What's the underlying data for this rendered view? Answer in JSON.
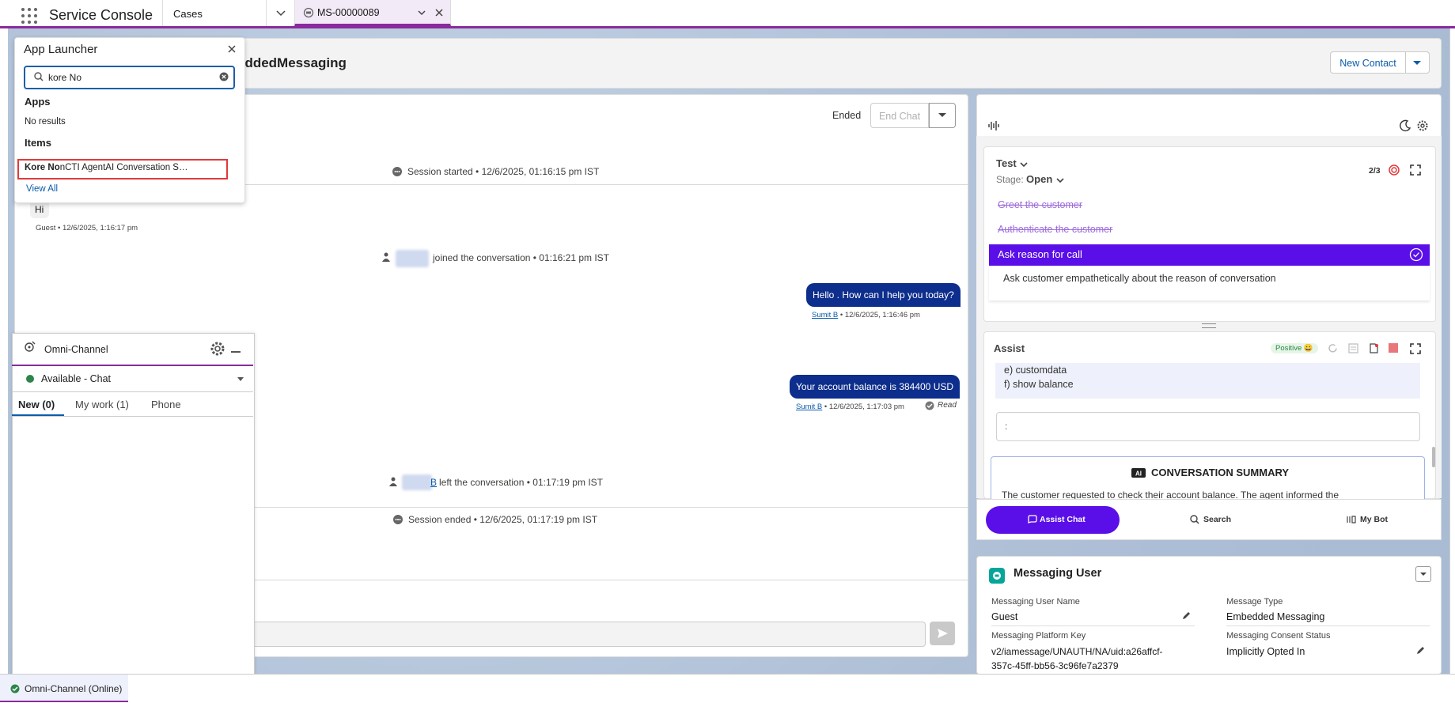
{
  "topbar": {
    "app_title": "Service Console",
    "tabs": [
      {
        "label": "Cases"
      },
      {
        "label": "MS-00000089"
      }
    ]
  },
  "header": {
    "title": "eddedMessaging",
    "new_contact_label": "New Contact"
  },
  "chat": {
    "status": "Ended",
    "end_chat_label": "End Chat",
    "session_started": "Session started • 12/6/2025, 01:16:15 pm IST",
    "guest_message": "Hi",
    "guest_meta": "Guest • 12/6/2025, 1:16:17 pm",
    "joined_text": "joined the conversation • 01:16:21 pm IST",
    "agent_message_1": "Hello . How can I help you today?",
    "agent_name_1": "Sumit B",
    "agent_meta_1": " • 12/6/2025, 1:16:46 pm",
    "agent_message_2": "Your account balance is 384400 USD",
    "agent_name_2": "Sumit B",
    "agent_meta_2": " • 12/6/2025, 1:17:03 pm",
    "read_label": "Read",
    "left_name_suffix": "B",
    "left_text": "left the conversation • 01:17:19 pm IST",
    "session_ended": "Session ended • 12/6/2025, 01:17:19 pm IST"
  },
  "launcher": {
    "title": "App Launcher",
    "search_value": "kore No",
    "apps_heading": "Apps",
    "no_results": "No results",
    "items_heading": "Items",
    "item_bold": "Kore No",
    "item_rest": "nCTI AgentAI Conversation S…",
    "view_all": "View All"
  },
  "omni": {
    "title": "Omni-Channel",
    "status": "Available - Chat",
    "status_color": "#2e844a",
    "tabs": [
      {
        "label": "New (0)"
      },
      {
        "label": "My work (1)"
      },
      {
        "label": "Phone"
      }
    ],
    "bottom_label": "Omni-Channel (Online)"
  },
  "agent_panel": {
    "flow_title": "Test",
    "stage_label": "Stage:",
    "stage_value": "Open",
    "progress": "2/3",
    "steps": [
      {
        "label": "Greet the customer",
        "done": true
      },
      {
        "label": "Authenticate the customer",
        "done": true
      },
      {
        "label": "Ask reason for call",
        "done": false,
        "active": true
      }
    ],
    "active_step_detail": "Ask customer empathetically about the reason of conversation",
    "assist_title": "Assist",
    "sentiment": "Positive 😀",
    "options": [
      "e) customdata",
      "f) show balance"
    ],
    "input_value": ":",
    "summary_title": "CONVERSATION SUMMARY",
    "summary_text": "The customer requested to check their account balance. The agent informed the",
    "nav": [
      {
        "label": "Assist Chat"
      },
      {
        "label": "Search"
      },
      {
        "label": "My Bot"
      }
    ],
    "accent": "#5a0fe8"
  },
  "messaging_user": {
    "title": "Messaging User",
    "fields": {
      "name_label": "Messaging User Name",
      "name_value": "Guest",
      "type_label": "Message Type",
      "type_value": "Embedded Messaging",
      "platform_label": "Messaging Platform Key",
      "platform_value_1": "v2/iamessage/UNAUTH/NA/uid:a26affcf-",
      "platform_value_2": "357c-45ff-bb56-3c96fe7a2379",
      "consent_label": "Messaging Consent Status",
      "consent_value": "Implicitly Opted In"
    }
  }
}
